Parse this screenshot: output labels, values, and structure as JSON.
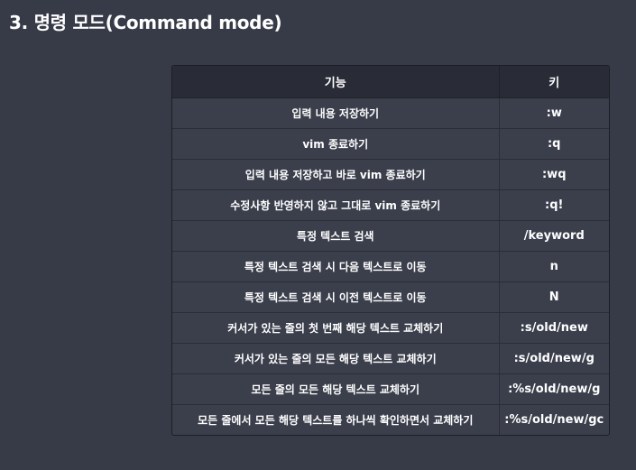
{
  "heading": "3. 명령 모드(Command mode)",
  "table": {
    "headers": [
      "기능",
      "키"
    ],
    "rows": [
      {
        "func": "입력 내용 저장하기",
        "key": ":w"
      },
      {
        "func": "vim 종료하기",
        "key": ":q"
      },
      {
        "func": "입력 내용 저장하고 바로 vim 종료하기",
        "key": ":wq"
      },
      {
        "func": "수정사항 반영하지 않고 그대로 vim 종료하기",
        "key": ":q!"
      },
      {
        "func": "특정 텍스트 검색",
        "key": "/keyword"
      },
      {
        "func": "특정 텍스트 검색 시 다음 텍스트로 이동",
        "key": "n"
      },
      {
        "func": "특정 텍스트 검색 시 이전 텍스트로 이동",
        "key": "N"
      },
      {
        "func": "커서가 있는 줄의 첫 번째 해당 텍스트 교체하기",
        "key": ":s/old/new"
      },
      {
        "func": "커서가 있는 줄의 모든 해당 텍스트 교체하기",
        "key": ":s/old/new/g"
      },
      {
        "func": "모든 줄의 모든 해당 텍스트 교체하기",
        "key": ":%s/old/new/g"
      },
      {
        "func": "모든 줄에서 모든 해당 텍스트를 하나씩 확인하면서 교체하기",
        "key": ":%s/old/new/gc"
      }
    ]
  }
}
